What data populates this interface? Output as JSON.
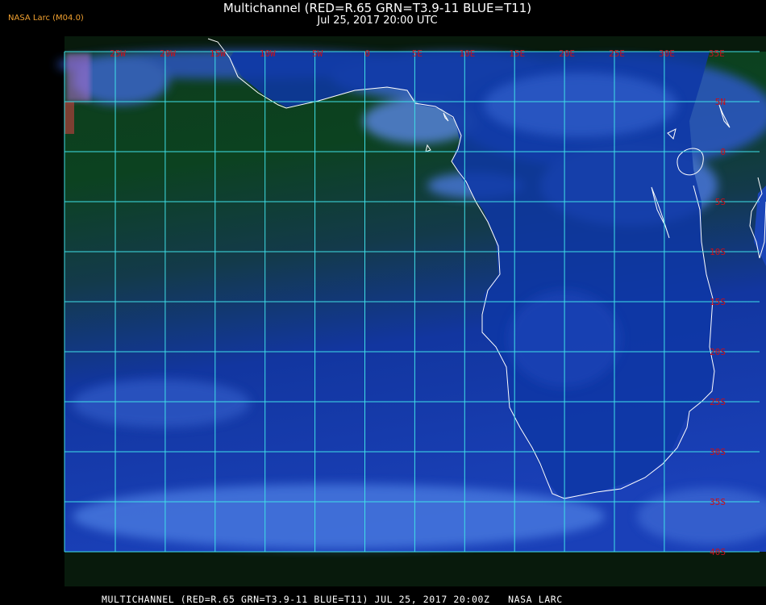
{
  "header": {
    "org_label": "NASA Larc (M04.0)",
    "title": "Multichannel (RED=R.65 GRN=T3.9-11 BLUE=T11)",
    "subtitle": "Jul 25, 2017 20:00 UTC"
  },
  "map": {
    "lon_labels": [
      "25W",
      "20W",
      "15W",
      "10W",
      "5W",
      "0",
      "5E",
      "10E",
      "15E",
      "20E",
      "25E",
      "30E",
      "35E"
    ],
    "lat_labels": [
      "5N",
      "0",
      "5S",
      "10S",
      "15S",
      "20S",
      "25S",
      "30S",
      "35S",
      "40S"
    ],
    "colors": {
      "grid": "#3fe0e8",
      "label": "#c8101a",
      "coast": "#ffffff",
      "ocean_north": "#0a3a1a",
      "ocean_south": "#1233a0",
      "land": "#0f38a8",
      "cloud": "#4a78e0"
    }
  },
  "footer": {
    "text": "MULTICHANNEL (RED=R.65 GRN=T3.9-11 BLUE=T11) JUL 25, 2017 20:00Z   NASA LARC"
  }
}
